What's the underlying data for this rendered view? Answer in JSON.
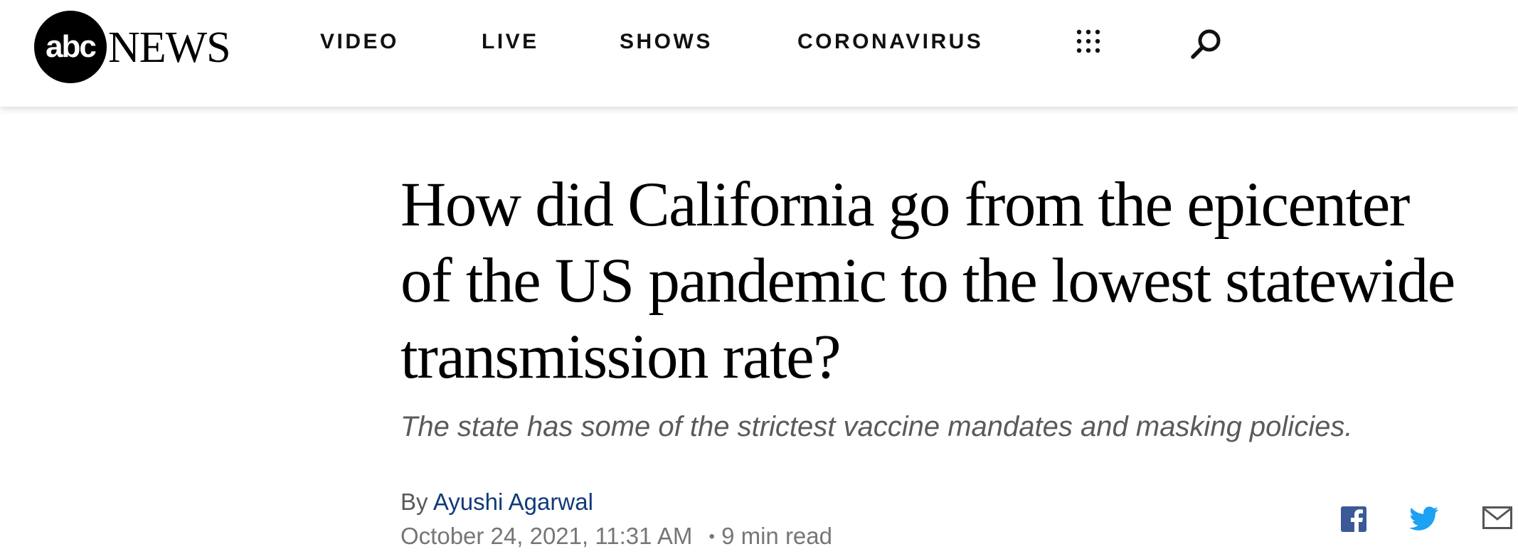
{
  "header": {
    "logo_abc": "abc",
    "logo_news": "NEWS",
    "nav": [
      "VIDEO",
      "LIVE",
      "SHOWS",
      "CORONAVIRUS"
    ],
    "icons": [
      "grid-menu-icon",
      "search-icon"
    ]
  },
  "article": {
    "headline": "How did California go from the epicenter of the US pandemic to the lowest statewide transmission rate?",
    "subhead": "The state has some of the strictest vaccine mandates and masking policies.",
    "by_label": "By",
    "author": "Ayushi Agarwal",
    "date": "October 24, 2021, 11:31 AM",
    "separator": "•",
    "read_time": "9 min read"
  },
  "share": {
    "icons": [
      "facebook-icon",
      "twitter-icon",
      "email-icon"
    ]
  },
  "colors": {
    "author_link": "#123a7a",
    "facebook": "#3b5998",
    "twitter": "#1da1f2",
    "email": "#555555",
    "subhead": "#5a5a5a"
  }
}
